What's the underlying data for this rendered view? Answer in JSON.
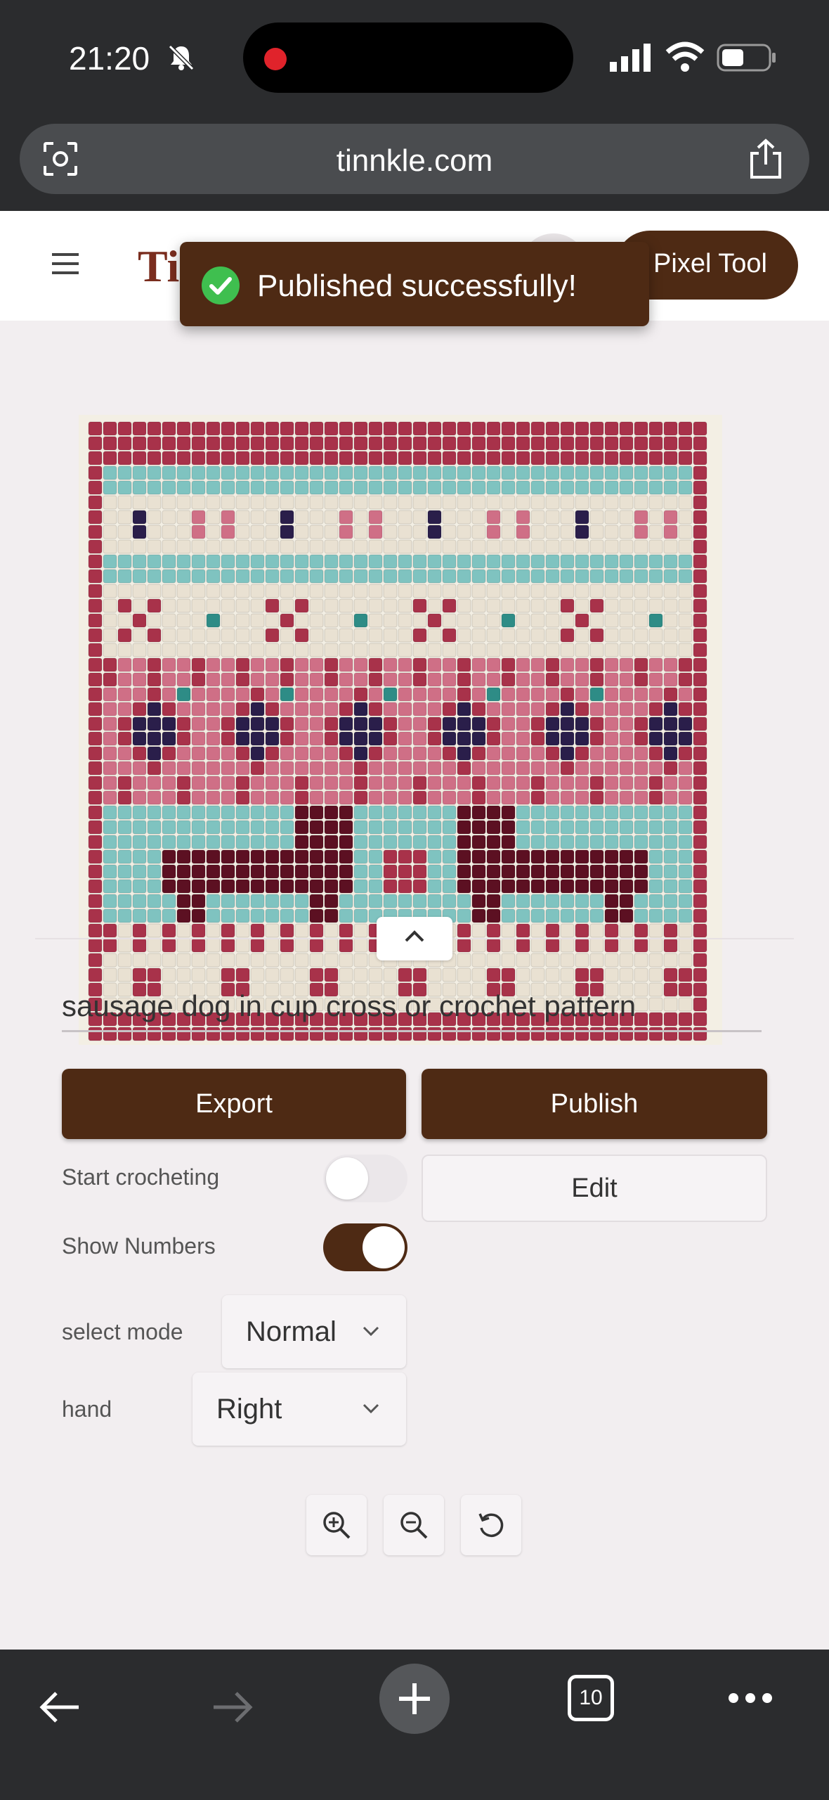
{
  "status_bar": {
    "time": "21:20"
  },
  "browser": {
    "url": "tinnkle.com",
    "tab_count": "10"
  },
  "header": {
    "logo_text": "Ti",
    "pixel_tool_label": "Pixel Tool"
  },
  "toast": {
    "message": "Published successfully!"
  },
  "editor": {
    "title_value": "sausage dog in cup cross or crochet pattern",
    "export_label": "Export",
    "publish_label": "Publish",
    "edit_label": "Edit",
    "start_crocheting_label": "Start crocheting",
    "start_crocheting_on": false,
    "show_numbers_label": "Show Numbers",
    "show_numbers_on": true,
    "select_mode_label": "select mode",
    "select_mode_value": "Normal",
    "hand_label": "hand",
    "hand_value": "Right"
  },
  "pattern_colors": {
    "cream": "#e9e1d2",
    "crimson": "#a8324a",
    "pink": "#cf6f86",
    "teal": "#7fc3c0",
    "dark_teal": "#2e8c86",
    "navy": "#2a1e4a",
    "maroon": "#5c1022"
  },
  "colors": {
    "brand_brown": "#4e2a14",
    "success_green": "#3fbf4f"
  }
}
